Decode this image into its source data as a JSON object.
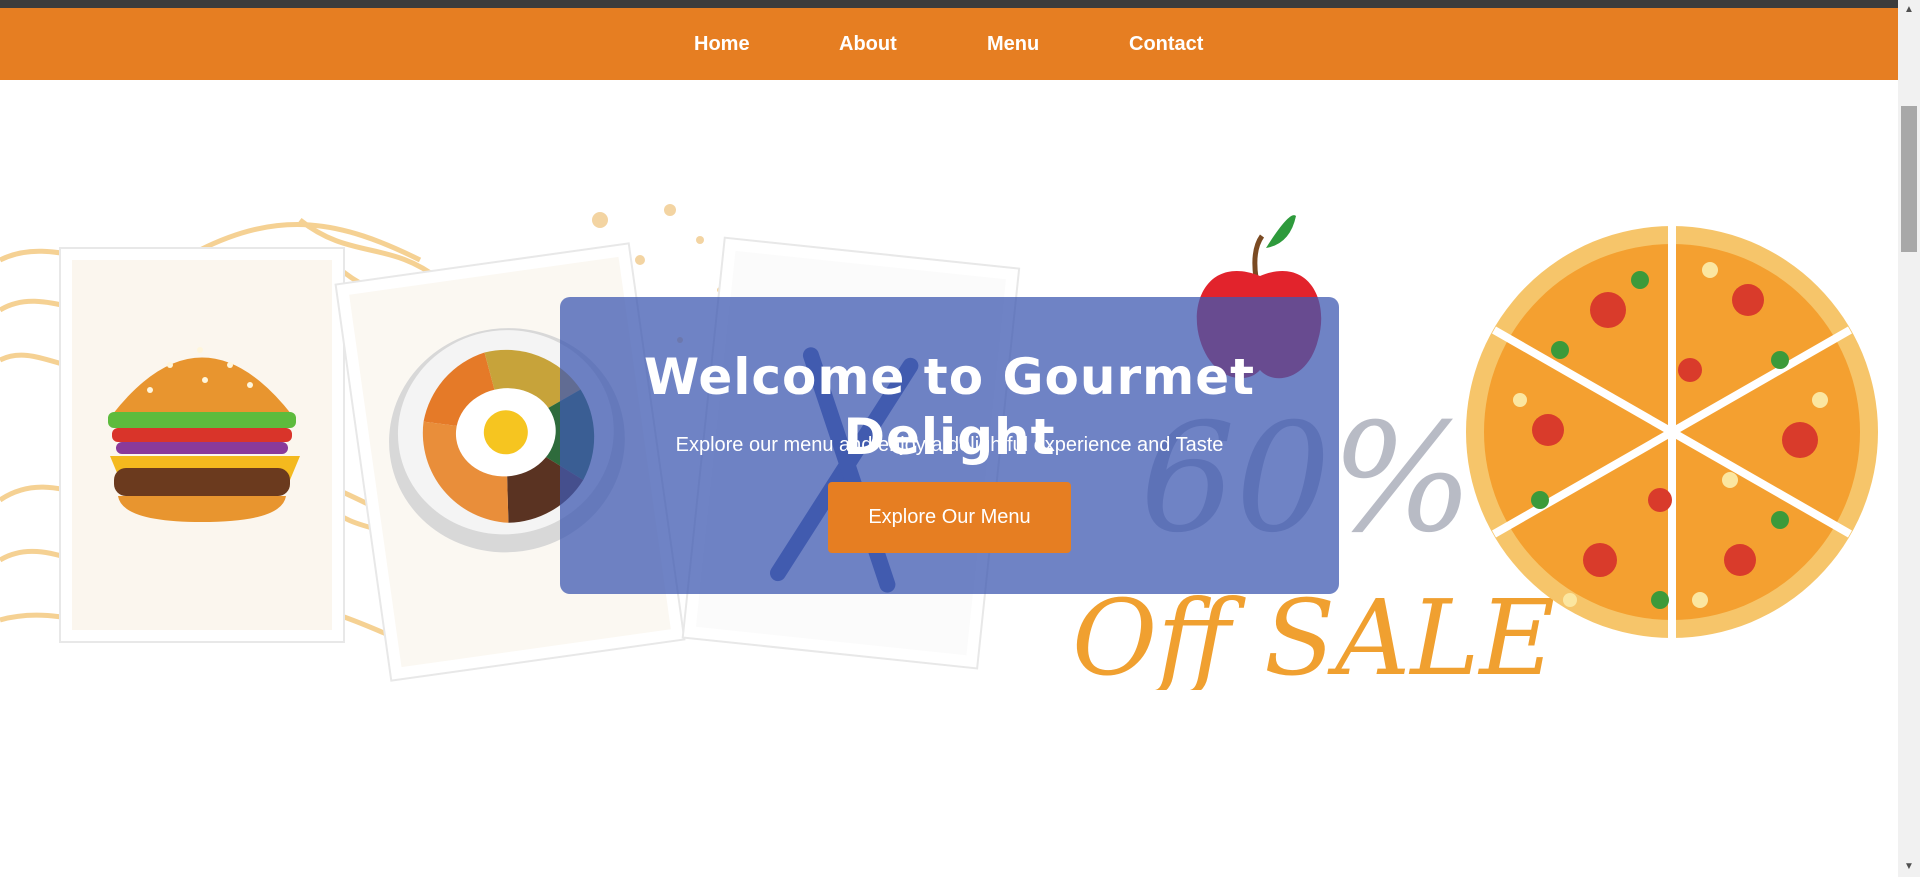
{
  "nav": {
    "items": [
      {
        "label": "Home"
      },
      {
        "label": "About"
      },
      {
        "label": "Menu"
      },
      {
        "label": "Contact"
      }
    ]
  },
  "hero": {
    "title": "Welcome to Gourmet Delight",
    "subtitle": "Explore our menu and enjoy a delightful experience and Taste",
    "button_label": "Explore Our Menu"
  },
  "banner": {
    "discount_text": "60%",
    "sale_text": "Off SALE"
  },
  "colors": {
    "nav_background": "#e67e22",
    "button_background": "#e67e22",
    "hero_overlay": "#3f5ab2",
    "sale_text": "#f0a030"
  },
  "icons": [
    "burger-icon",
    "bibimbap-bowl-icon",
    "fork-knife-icon",
    "apple-icon",
    "pizza-icon"
  ]
}
